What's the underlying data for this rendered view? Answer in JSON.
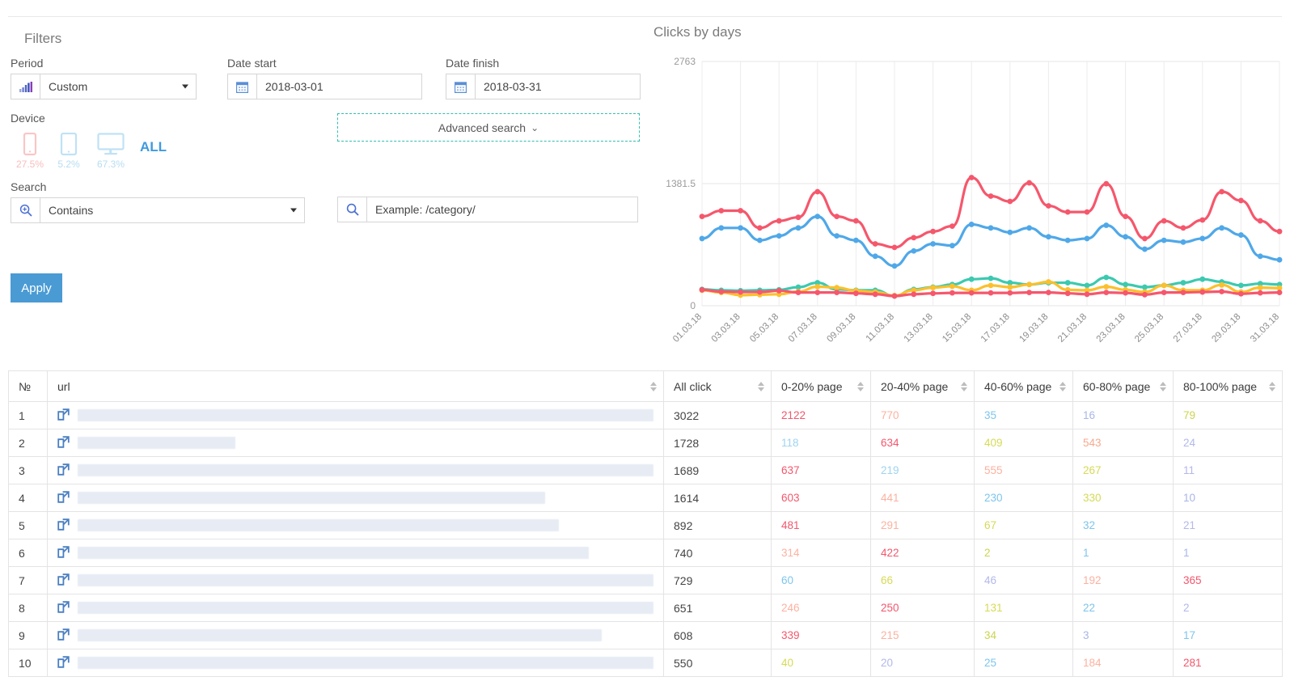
{
  "filters": {
    "title": "Filters",
    "period": {
      "label": "Period",
      "value": "Custom",
      "icon": "bar-chart-icon"
    },
    "date_start": {
      "label": "Date start",
      "value": "2018-03-01",
      "icon": "calendar-icon"
    },
    "date_finish": {
      "label": "Date finish",
      "value": "2018-03-31",
      "icon": "calendar-icon"
    },
    "device": {
      "label": "Device",
      "all_label": "ALL",
      "items": [
        {
          "name": "mobile",
          "pct": "27.5%",
          "color": "#f9c6c6"
        },
        {
          "name": "tablet",
          "pct": "5.2%",
          "color": "#bfe2f5"
        },
        {
          "name": "desktop",
          "pct": "67.3%",
          "color": "#bfe2f5"
        }
      ]
    },
    "advanced_search": {
      "label": "Advanced search",
      "caret": "⌄"
    },
    "search": {
      "label": "Search",
      "mode_value": "Contains",
      "input_value": "",
      "input_placeholder": "Example: /category/"
    },
    "apply_label": "Apply"
  },
  "chart": {
    "title": "Clicks by days"
  },
  "chart_data": {
    "type": "line",
    "title": "Clicks by days",
    "xlabel": "",
    "ylabel": "",
    "ylim": [
      0,
      2763
    ],
    "yticks": [
      0,
      1381.5,
      2763
    ],
    "ytick_labels": [
      "0",
      "1381.5",
      "2763"
    ],
    "grid": true,
    "legend": "none",
    "x": [
      "01.03.18",
      "02.03.18",
      "03.03.18",
      "04.03.18",
      "05.03.18",
      "06.03.18",
      "07.03.18",
      "08.03.18",
      "09.03.18",
      "10.03.18",
      "11.03.18",
      "12.03.18",
      "13.03.18",
      "14.03.18",
      "15.03.18",
      "16.03.18",
      "17.03.18",
      "18.03.18",
      "19.03.18",
      "20.03.18",
      "21.03.18",
      "22.03.18",
      "23.03.18",
      "24.03.18",
      "25.03.18",
      "26.03.18",
      "27.03.18",
      "28.03.18",
      "29.03.18",
      "30.03.18",
      "31.03.18"
    ],
    "xtick_labels": [
      "01.03.18",
      "03.03.18",
      "05.03.18",
      "07.03.18",
      "09.03.18",
      "11.03.18",
      "13.03.18",
      "15.03.18",
      "17.03.18",
      "19.03.18",
      "21.03.18",
      "23.03.18",
      "25.03.18",
      "27.03.18",
      "29.03.18",
      "31.03.18"
    ],
    "series": [
      {
        "name": "0-20% page",
        "color": "#f5576c",
        "values": [
          1010,
          1075,
          1075,
          880,
          960,
          1000,
          1290,
          1010,
          960,
          700,
          660,
          770,
          840,
          900,
          1450,
          1240,
          1180,
          1390,
          1130,
          1060,
          1060,
          1380,
          1010,
          760,
          960,
          880,
          970,
          1290,
          1190,
          960,
          840
        ]
      },
      {
        "name": "20-40% page",
        "color": "#4fa8e8",
        "values": [
          760,
          880,
          880,
          740,
          790,
          880,
          1010,
          790,
          740,
          560,
          450,
          620,
          700,
          680,
          920,
          880,
          830,
          880,
          780,
          740,
          760,
          910,
          780,
          640,
          740,
          720,
          760,
          880,
          800,
          560,
          520
        ]
      },
      {
        "name": "40-60% page",
        "color": "#3cc9b0",
        "values": [
          185,
          175,
          170,
          175,
          180,
          210,
          260,
          185,
          175,
          175,
          110,
          185,
          210,
          240,
          300,
          310,
          260,
          240,
          260,
          260,
          230,
          320,
          240,
          210,
          230,
          260,
          300,
          270,
          230,
          250,
          240
        ]
      },
      {
        "name": "60-80% page",
        "color": "#fbc02d",
        "values": [
          175,
          150,
          120,
          125,
          130,
          160,
          215,
          205,
          170,
          155,
          115,
          175,
          205,
          220,
          175,
          230,
          210,
          240,
          270,
          180,
          175,
          215,
          180,
          155,
          230,
          175,
          175,
          235,
          155,
          205,
          200
        ]
      },
      {
        "name": "80-100% page",
        "color": "#f5576c",
        "values": [
          180,
          160,
          155,
          155,
          170,
          150,
          150,
          150,
          140,
          130,
          110,
          130,
          140,
          145,
          145,
          145,
          145,
          150,
          150,
          140,
          130,
          150,
          145,
          125,
          150,
          150,
          155,
          160,
          135,
          145,
          150
        ]
      }
    ]
  },
  "table": {
    "columns": [
      {
        "key": "no",
        "label": "№",
        "sortable": false
      },
      {
        "key": "url",
        "label": "url",
        "sortable": true
      },
      {
        "key": "all_click",
        "label": "All click",
        "sortable": true
      },
      {
        "key": "p0_20",
        "label": "0-20% page",
        "sortable": true
      },
      {
        "key": "p20_40",
        "label": "20-40% page",
        "sortable": true
      },
      {
        "key": "p40_60",
        "label": "40-60% page",
        "sortable": true
      },
      {
        "key": "p60_80",
        "label": "60-80% page",
        "sortable": true
      },
      {
        "key": "p80_100",
        "label": "80-100% page",
        "sortable": true
      }
    ],
    "url_icon": "external-link-icon",
    "rows": [
      {
        "no": "1",
        "url_redacted_width": 730,
        "all_click": "3022",
        "p0_20": "2122",
        "p20_40": "770",
        "p40_60": "35",
        "p60_80": "16",
        "p80_100": "79",
        "colors": [
          "#f2576c",
          "#fbb2a0",
          "#7ec5ec",
          "#a9b6e8",
          "#cdd44e"
        ]
      },
      {
        "no": "2",
        "url_redacted_width": 195,
        "all_click": "1728",
        "p0_20": "118",
        "p20_40": "634",
        "p40_60": "409",
        "p60_80": "543",
        "p80_100": "24",
        "colors": [
          "#9fd4f0",
          "#f2576c",
          "#d6da55",
          "#f7a98e",
          "#b3b8ea"
        ]
      },
      {
        "no": "3",
        "url_redacted_width": 720,
        "all_click": "1689",
        "p0_20": "637",
        "p20_40": "219",
        "p40_60": "555",
        "p60_80": "267",
        "p80_100": "11",
        "colors": [
          "#f2576c",
          "#9fd4f0",
          "#fbb2a0",
          "#d6da55",
          "#b3b8ea"
        ]
      },
      {
        "no": "4",
        "url_redacted_width": 578,
        "all_click": "1614",
        "p0_20": "603",
        "p20_40": "441",
        "p40_60": "230",
        "p60_80": "330",
        "p80_100": "10",
        "colors": [
          "#f2576c",
          "#fbb2a0",
          "#7ec5ec",
          "#d6da55",
          "#a9b6e8"
        ]
      },
      {
        "no": "5",
        "url_redacted_width": 595,
        "all_click": "892",
        "p0_20": "481",
        "p20_40": "291",
        "p40_60": "67",
        "p60_80": "32",
        "p80_100": "21",
        "colors": [
          "#f2576c",
          "#fbb2a0",
          "#d6da55",
          "#7ec5ec",
          "#b3b8ea"
        ]
      },
      {
        "no": "6",
        "url_redacted_width": 632,
        "all_click": "740",
        "p0_20": "314",
        "p20_40": "422",
        "p40_60": "2",
        "p60_80": "1",
        "p80_100": "1",
        "colors": [
          "#fbb2a0",
          "#f2576c",
          "#cdd44e",
          "#7ec5ec",
          "#a9b6e8"
        ]
      },
      {
        "no": "7",
        "url_redacted_width": 730,
        "all_click": "729",
        "p0_20": "60",
        "p20_40": "66",
        "p40_60": "46",
        "p60_80": "192",
        "p80_100": "365",
        "colors": [
          "#7ec5ec",
          "#d6da55",
          "#b3b8ea",
          "#fbb2a0",
          "#f2576c"
        ]
      },
      {
        "no": "8",
        "url_redacted_width": 730,
        "all_click": "651",
        "p0_20": "246",
        "p20_40": "250",
        "p40_60": "131",
        "p60_80": "22",
        "p80_100": "2",
        "colors": [
          "#fbb2a0",
          "#f2576c",
          "#d6da55",
          "#7ec5ec",
          "#b3b8ea"
        ]
      },
      {
        "no": "9",
        "url_redacted_width": 648,
        "all_click": "608",
        "p0_20": "339",
        "p20_40": "215",
        "p40_60": "34",
        "p60_80": "3",
        "p80_100": "17",
        "colors": [
          "#f2576c",
          "#fbb2a0",
          "#cdd44e",
          "#a9b6e8",
          "#7ec5ec"
        ]
      },
      {
        "no": "10",
        "url_redacted_width": 730,
        "all_click": "550",
        "p0_20": "40",
        "p20_40": "20",
        "p40_60": "25",
        "p60_80": "184",
        "p80_100": "281",
        "colors": [
          "#d6da55",
          "#b3b8ea",
          "#7ec5ec",
          "#fbb2a0",
          "#f2576c"
        ]
      }
    ]
  }
}
